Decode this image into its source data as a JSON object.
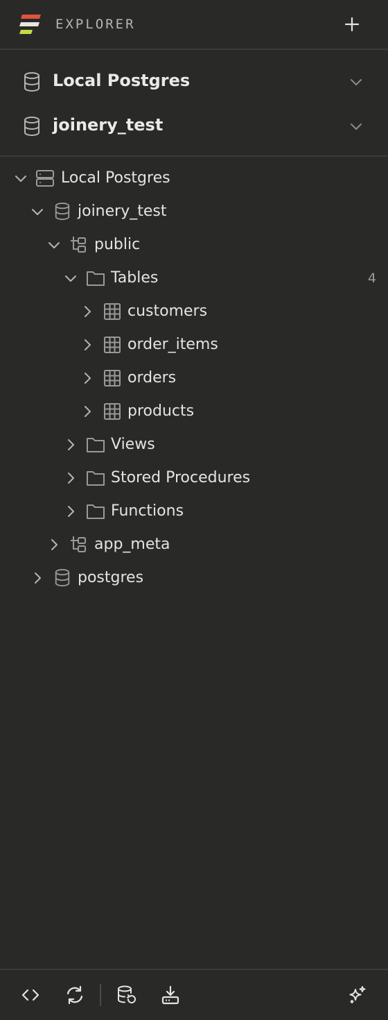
{
  "header": {
    "title": "EXPLORER",
    "add_icon": "plus-icon",
    "logo_colors": [
      "#e2543a",
      "#e8e6df",
      "#c6dc42"
    ]
  },
  "connections": [
    {
      "label": "Local Postgres",
      "icon": "database-icon",
      "state": "collapsed"
    },
    {
      "label": "joinery_test",
      "icon": "database-icon",
      "state": "collapsed"
    }
  ],
  "tree": {
    "server": {
      "label": "Local Postgres",
      "icon": "server-icon",
      "expanded": true
    },
    "database": {
      "label": "joinery_test",
      "icon": "database-icon",
      "expanded": true
    },
    "schema_public": {
      "label": "public",
      "icon": "schema-icon",
      "expanded": true
    },
    "tables_folder": {
      "label": "Tables",
      "count": "4",
      "icon": "folder-icon",
      "expanded": true
    },
    "tables": [
      {
        "label": "customers",
        "icon": "table-icon"
      },
      {
        "label": "order_items",
        "icon": "table-icon"
      },
      {
        "label": "orders",
        "icon": "table-icon"
      },
      {
        "label": "products",
        "icon": "table-icon"
      }
    ],
    "folders": [
      {
        "label": "Views",
        "icon": "folder-icon"
      },
      {
        "label": "Stored Procedures",
        "icon": "folder-icon"
      },
      {
        "label": "Functions",
        "icon": "folder-icon"
      }
    ],
    "schema_app_meta": {
      "label": "app_meta",
      "icon": "schema-icon",
      "expanded": false
    },
    "database_postgres": {
      "label": "postgres",
      "icon": "database-icon",
      "expanded": false
    }
  },
  "footer": {
    "buttons": [
      "code-icon",
      "refresh-icon",
      "database-restore-icon",
      "download-icon",
      "sparkles-icon"
    ]
  },
  "colors": {
    "background": "#292a28",
    "divider": "#3b3c3a",
    "text": "#e6e4df",
    "muted": "#9c9a95"
  }
}
